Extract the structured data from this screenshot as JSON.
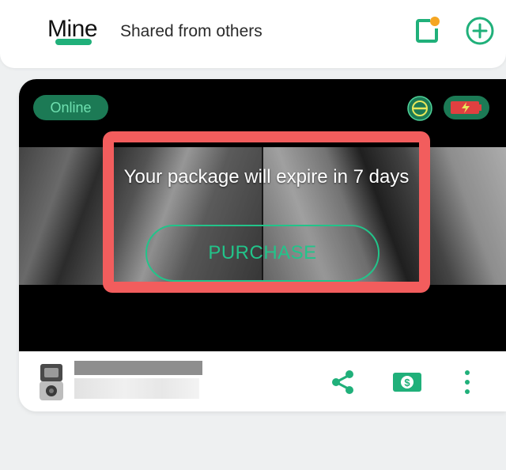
{
  "header": {
    "tabs": [
      {
        "label": "Mine",
        "active": true
      },
      {
        "label": "Shared from others",
        "active": false
      }
    ],
    "icons": {
      "messages": "message-notification-icon",
      "add": "plus-circle-icon"
    }
  },
  "camera_card": {
    "status": "Online",
    "alert": {
      "message": "Your package will expire in 7 days",
      "button_label": "PURCHASE"
    },
    "status_icons": [
      "privacy-icon",
      "battery-charging-icon"
    ],
    "footer_icons": [
      "share-icon",
      "cloud-storage-icon",
      "more-vertical-icon"
    ]
  },
  "colors": {
    "accent": "#20b07a",
    "highlight_box": "#f25d5d",
    "notification_dot": "#f5a623"
  }
}
